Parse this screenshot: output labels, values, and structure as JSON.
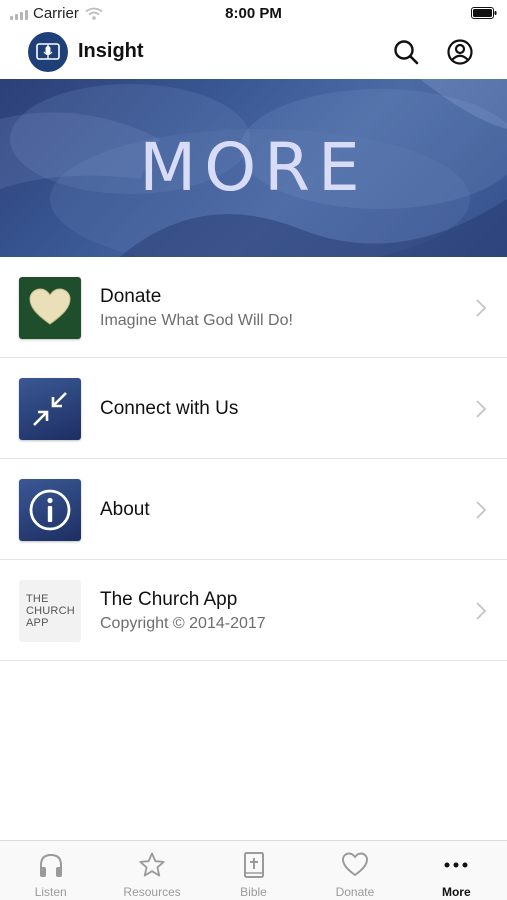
{
  "status_bar": {
    "carrier": "Carrier",
    "time": "8:00 PM"
  },
  "header": {
    "app_name": "Insight",
    "icons": [
      "logo-icon",
      "search-icon",
      "account-icon"
    ]
  },
  "hero": {
    "title": "MORE"
  },
  "menu": [
    {
      "title": "Donate",
      "subtitle": "Imagine What God Will Do!",
      "icon": "heart-icon"
    },
    {
      "title": "Connect with Us",
      "subtitle": "",
      "icon": "arrows-inward-icon"
    },
    {
      "title": "About",
      "subtitle": "",
      "icon": "info-icon"
    },
    {
      "title": "The Church App",
      "subtitle": "Copyright © 2014-2017",
      "icon": "the-church-app-logo",
      "thumb_text": [
        "THE",
        "CHURCH",
        "APP"
      ]
    }
  ],
  "tabs": [
    {
      "label": "Listen",
      "icon": "headphones-icon",
      "active": false
    },
    {
      "label": "Resources",
      "icon": "star-icon",
      "active": false
    },
    {
      "label": "Bible",
      "icon": "bible-icon",
      "active": false
    },
    {
      "label": "Donate",
      "icon": "heart-icon",
      "active": false
    },
    {
      "label": "More",
      "icon": "more-dots-icon",
      "active": true
    }
  ],
  "colors": {
    "brand_blue": "#1f3f78",
    "hero_text": "#d9dcf7",
    "donate_green": "#1f4e2c",
    "inactive_tab": "#9a9a9a"
  }
}
